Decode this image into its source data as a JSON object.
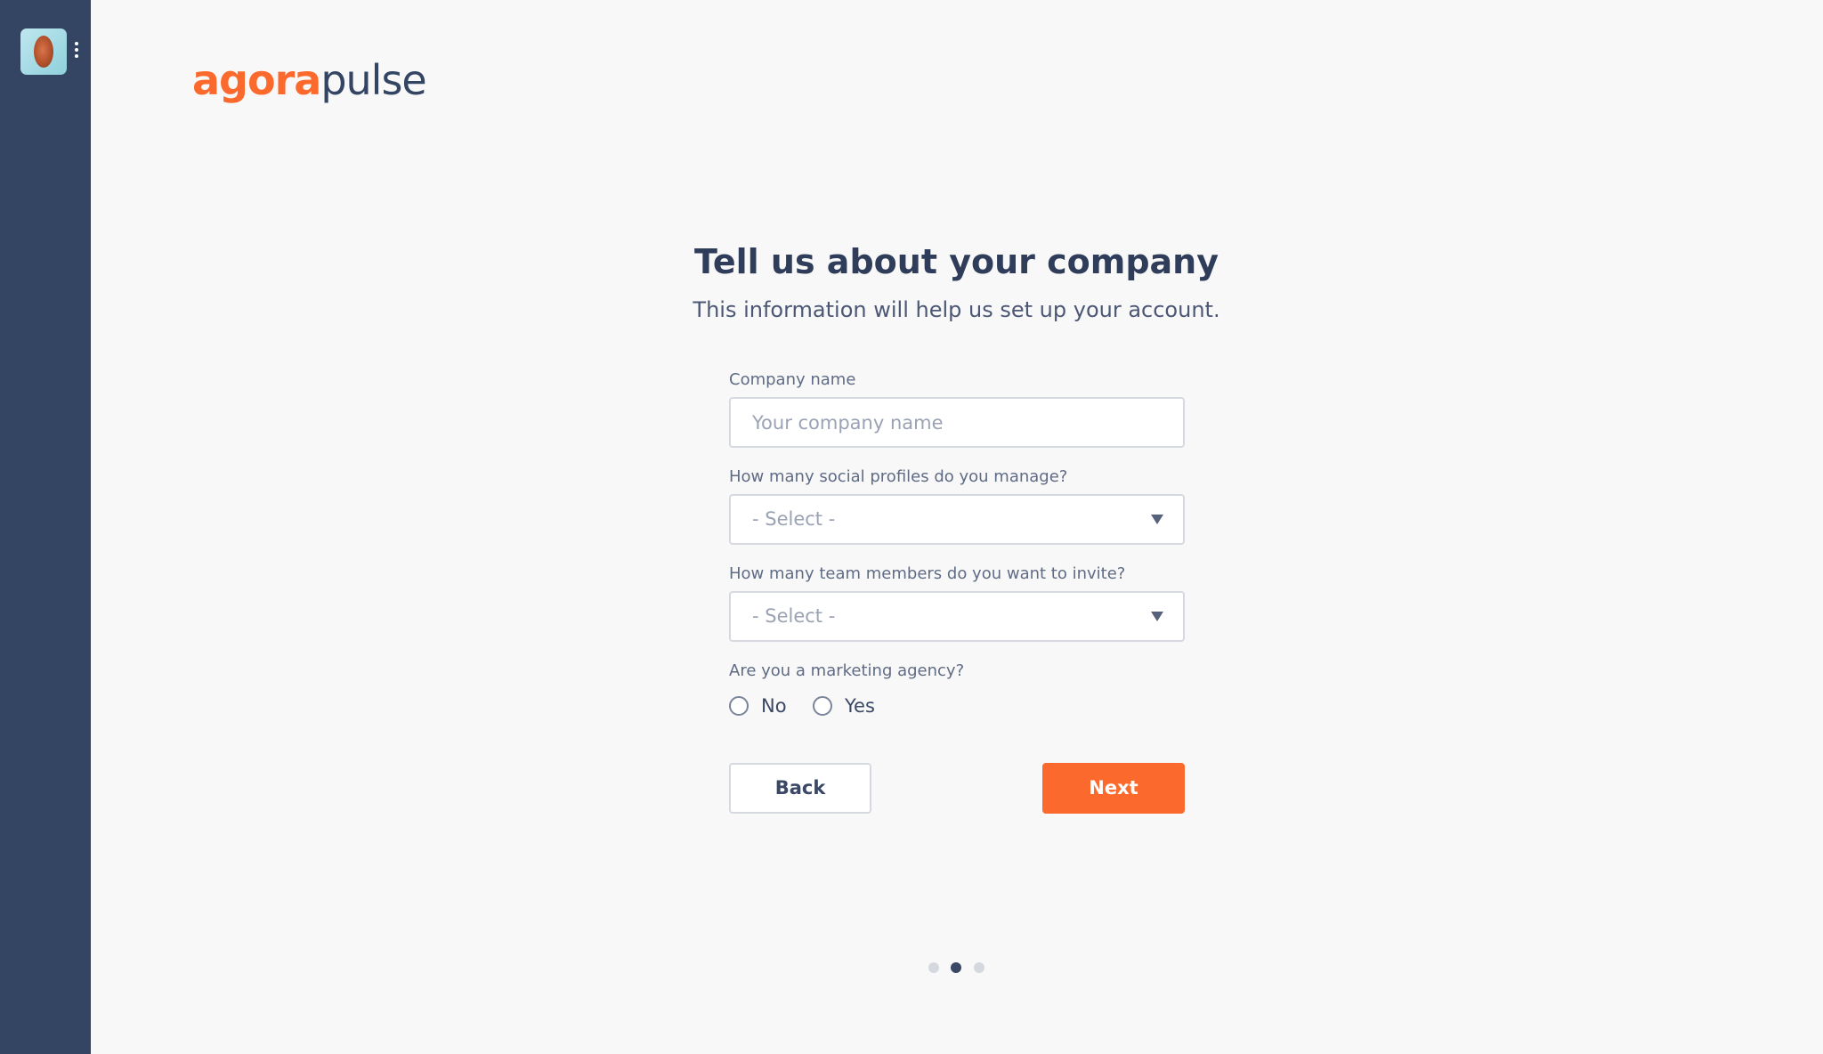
{
  "brand": {
    "logo_part1": "agora",
    "logo_part2": "pulse",
    "accent_color": "#fb6a2c",
    "sidebar_color": "#344563"
  },
  "sidebar": {
    "avatar_icon": "user-avatar",
    "menu_icon": "kebab-menu-icon"
  },
  "header": {
    "title": "Tell us about your company",
    "subtitle": "This information will help us set up your account."
  },
  "form": {
    "company_name": {
      "label": "Company name",
      "placeholder": "Your company name",
      "value": ""
    },
    "social_profiles": {
      "label": "How many social profiles do you manage?",
      "selected": "- Select -"
    },
    "team_members": {
      "label": "How many team members do you want to invite?",
      "selected": "- Select -"
    },
    "agency": {
      "label": "Are you a marketing agency?",
      "options": [
        "No",
        "Yes"
      ],
      "selected": null
    }
  },
  "actions": {
    "back_label": "Back",
    "next_label": "Next"
  },
  "progress": {
    "steps": 3,
    "current_step": 2
  }
}
